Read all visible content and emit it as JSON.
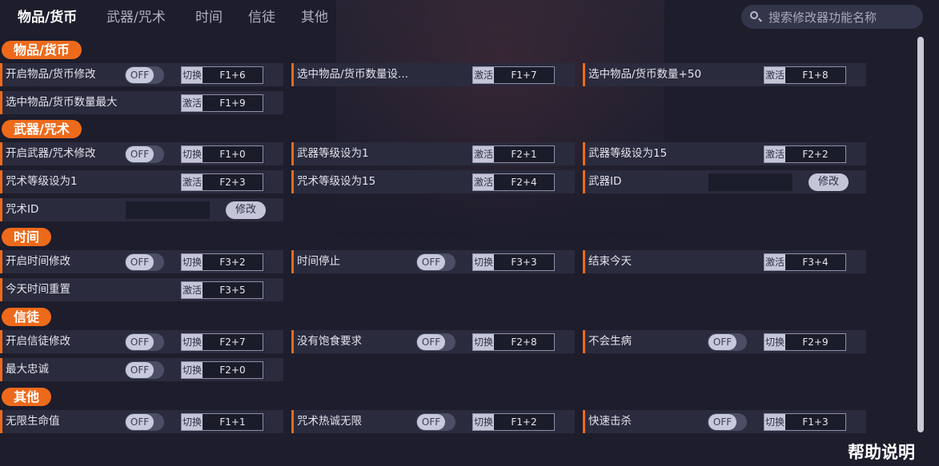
{
  "tabs": [
    "物品/货币",
    "武器/咒术",
    "时间",
    "信徒",
    "其他"
  ],
  "search": {
    "placeholder": "搜索修改器功能名称"
  },
  "sections": [
    {
      "title": "物品/货币",
      "rows": [
        [
          {
            "label": "开启物品/货币修改",
            "toggle": "OFF",
            "action": "切换",
            "key": "F1+6"
          },
          {
            "label": "选中物品/货币数量设...",
            "action": "激活",
            "key": "F1+7"
          },
          {
            "label": "选中物品/货币数量+50",
            "action": "激活",
            "key": "F1+8"
          }
        ],
        [
          {
            "label": "选中物品/货币数量最大",
            "action": "激活",
            "key": "F1+9"
          }
        ]
      ]
    },
    {
      "title": "武器/咒术",
      "rows": [
        [
          {
            "label": "开启武器/咒术修改",
            "toggle": "OFF",
            "action": "切换",
            "key": "F1+0"
          },
          {
            "label": "武器等级设为1",
            "action": "激活",
            "key": "F2+1"
          },
          {
            "label": "武器等级设为15",
            "action": "激活",
            "key": "F2+2"
          }
        ],
        [
          {
            "label": "咒术等级设为1",
            "action": "激活",
            "key": "F2+3"
          },
          {
            "label": "咒术等级设为15",
            "action": "激活",
            "key": "F2+4"
          },
          {
            "label": "武器ID",
            "input": "",
            "button": "修改"
          }
        ],
        [
          {
            "label": "咒术ID",
            "input": "",
            "button": "修改"
          }
        ]
      ]
    },
    {
      "title": "时间",
      "rows": [
        [
          {
            "label": "开启时间修改",
            "toggle": "OFF",
            "action": "切换",
            "key": "F3+2"
          },
          {
            "label": "时间停止",
            "toggle": "OFF",
            "action": "切换",
            "key": "F3+3"
          },
          {
            "label": "结束今天",
            "action": "激活",
            "key": "F3+4"
          }
        ],
        [
          {
            "label": "今天时间重置",
            "action": "激活",
            "key": "F3+5"
          }
        ]
      ]
    },
    {
      "title": "信徒",
      "rows": [
        [
          {
            "label": "开启信徒修改",
            "toggle": "OFF",
            "action": "切换",
            "key": "F2+7"
          },
          {
            "label": "没有饱食要求",
            "toggle": "OFF",
            "action": "切换",
            "key": "F2+8"
          },
          {
            "label": "不会生病",
            "toggle": "OFF",
            "action": "切换",
            "key": "F2+9"
          }
        ],
        [
          {
            "label": "最大忠诚",
            "toggle": "OFF",
            "action": "切换",
            "key": "F2+0"
          }
        ]
      ]
    },
    {
      "title": "其他",
      "rows": [
        [
          {
            "label": "无限生命值",
            "toggle": "OFF",
            "action": "切换",
            "key": "F1+1"
          },
          {
            "label": "咒术热诚无限",
            "toggle": "OFF",
            "action": "切换",
            "key": "F1+2"
          },
          {
            "label": "快速击杀",
            "toggle": "OFF",
            "action": "切换",
            "key": "F1+3"
          }
        ]
      ]
    }
  ],
  "help_label": "帮助说明",
  "colors": {
    "accent": "#ee6a1b",
    "background": "#1d1d2c",
    "panel": "#2a2b3d"
  }
}
